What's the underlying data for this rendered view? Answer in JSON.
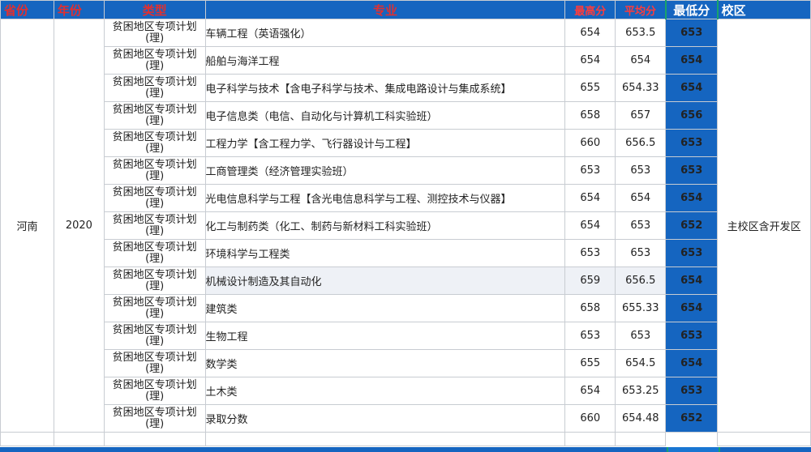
{
  "headers": {
    "province": "省份",
    "year": "年份",
    "type": "类型",
    "major": "专业",
    "max": "最高分",
    "avg": "平均分",
    "min": "最低分",
    "campus": "校区"
  },
  "group": {
    "province": "河南",
    "year": "2020",
    "campus": "主校区含开发区"
  },
  "type_label": {
    "line1": "贫困地区专项计划",
    "line2": "(理)"
  },
  "rows": [
    {
      "major": "车辆工程（英语强化）",
      "max": "654",
      "avg": "653.5",
      "min": "653"
    },
    {
      "major": "船舶与海洋工程",
      "max": "654",
      "avg": "654",
      "min": "654"
    },
    {
      "major": "电子科学与技术【含电子科学与技术、集成电路设计与集成系统】",
      "max": "655",
      "avg": "654.33",
      "min": "654"
    },
    {
      "major": "电子信息类（电信、自动化与计算机工科实验班）",
      "max": "658",
      "avg": "657",
      "min": "656"
    },
    {
      "major": "工程力学【含工程力学、飞行器设计与工程】",
      "max": "660",
      "avg": "656.5",
      "min": "653"
    },
    {
      "major": "工商管理类（经济管理实验班）",
      "max": "653",
      "avg": "653",
      "min": "653"
    },
    {
      "major": "光电信息科学与工程【含光电信息科学与工程、测控技术与仪器】",
      "max": "654",
      "avg": "654",
      "min": "654"
    },
    {
      "major": "化工与制药类（化工、制药与新材料工科实验班）",
      "max": "654",
      "avg": "653",
      "min": "652"
    },
    {
      "major": "环境科学与工程类",
      "max": "653",
      "avg": "653",
      "min": "653"
    },
    {
      "major": "机械设计制造及其自动化",
      "max": "659",
      "avg": "656.5",
      "min": "654"
    },
    {
      "major": "建筑类",
      "max": "658",
      "avg": "655.33",
      "min": "654"
    },
    {
      "major": "生物工程",
      "max": "653",
      "avg": "653",
      "min": "653"
    },
    {
      "major": "数学类",
      "max": "655",
      "avg": "654.5",
      "min": "654"
    },
    {
      "major": "土木类",
      "max": "654",
      "avg": "653.25",
      "min": "653"
    },
    {
      "major": "录取分数",
      "max": "660",
      "avg": "654.48",
      "min": "652"
    }
  ],
  "colors": {
    "header_bg": "#1565c0",
    "header_text_red": "#e03030",
    "min_col_border": "#19a36b"
  }
}
